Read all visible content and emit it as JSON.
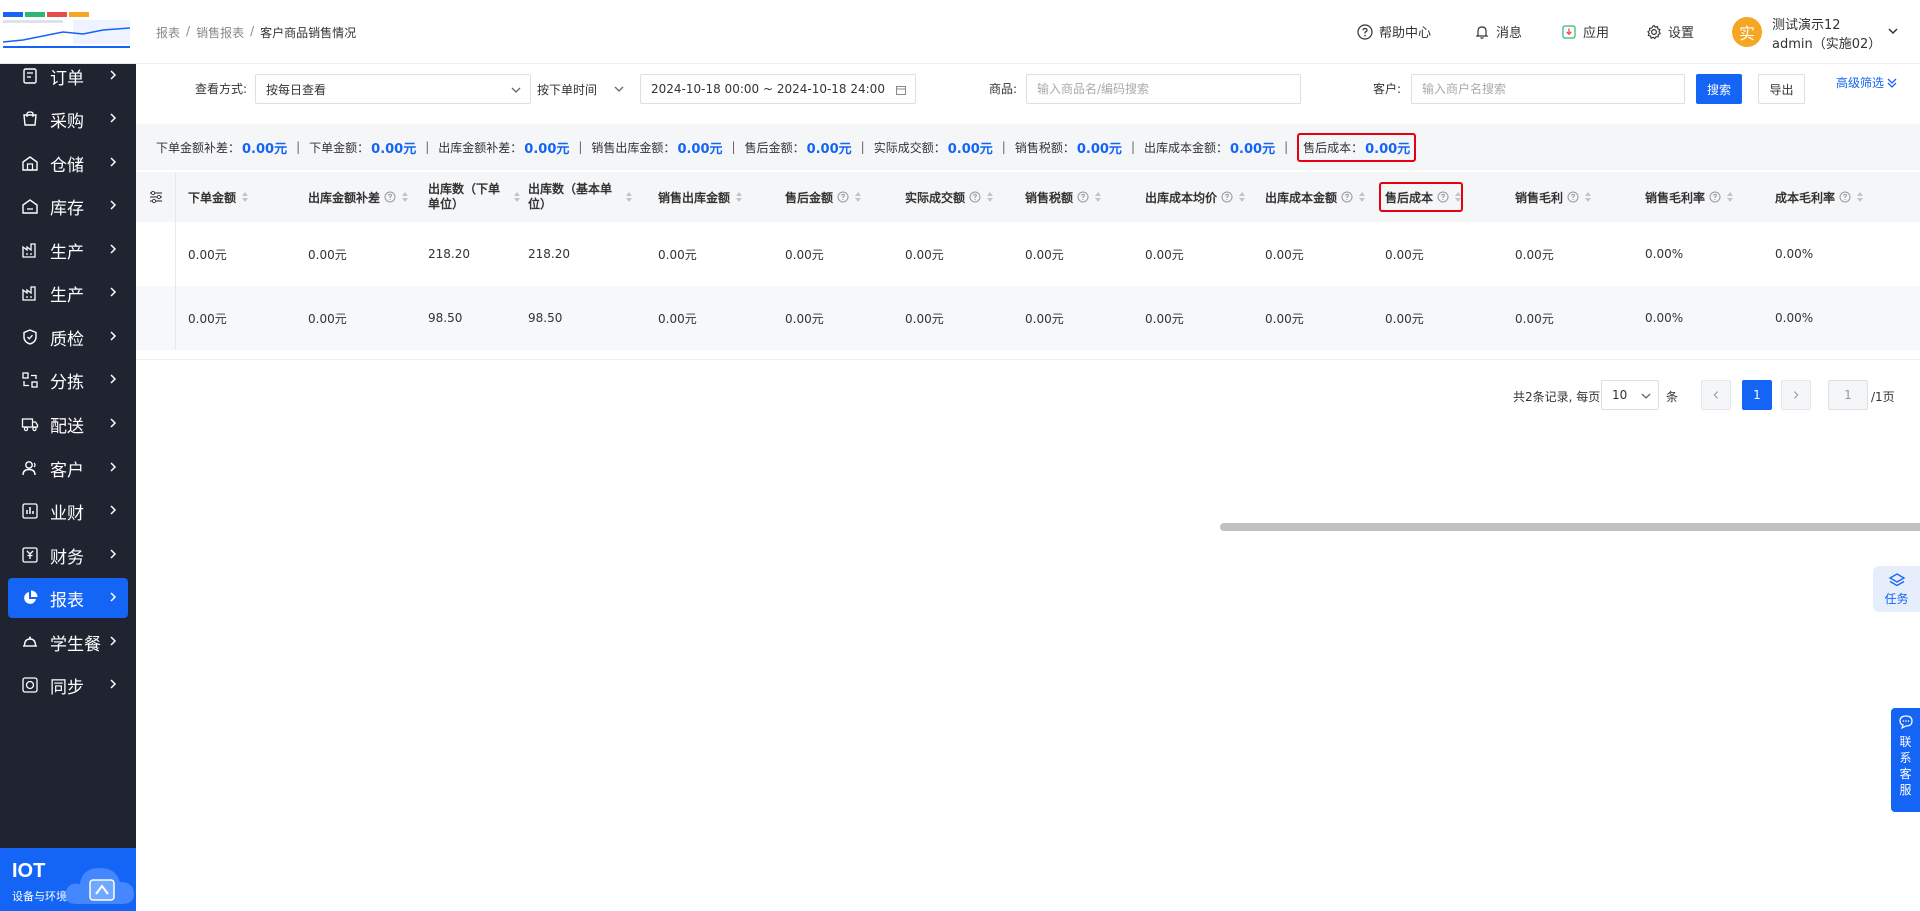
{
  "sidebar": {
    "items": [
      {
        "label": "订单",
        "icon": "order-icon"
      },
      {
        "label": "采购",
        "icon": "purchase-icon"
      },
      {
        "label": "仓储",
        "icon": "warehouse-icon"
      },
      {
        "label": "库存",
        "icon": "inventory-icon"
      },
      {
        "label": "生产",
        "icon": "factory-icon"
      },
      {
        "label": "生产",
        "icon": "factory-icon"
      },
      {
        "label": "质检",
        "icon": "shield-icon"
      },
      {
        "label": "分拣",
        "icon": "sort-icon"
      },
      {
        "label": "配送",
        "icon": "truck-icon"
      },
      {
        "label": "客户",
        "icon": "user-icon"
      },
      {
        "label": "业财",
        "icon": "bar-chart-icon"
      },
      {
        "label": "财务",
        "icon": "finance-icon"
      },
      {
        "label": "报表",
        "icon": "pie-chart-icon",
        "active": true
      },
      {
        "label": "学生餐",
        "icon": "dish-icon"
      },
      {
        "label": "同步",
        "icon": "sync-icon"
      }
    ],
    "iot": {
      "title": "IOT",
      "subtitle": "设备与环境"
    }
  },
  "header": {
    "breadcrumb": [
      "报表",
      "销售报表",
      "客户商品销售情况"
    ],
    "help": "帮助中心",
    "message": "消息",
    "apps": "应用",
    "settings": "设置",
    "avatar_char": "实",
    "user_name": "测试演示12",
    "user_sub": "admin（实施02）"
  },
  "filter": {
    "view_mode_label": "查看方式:",
    "view_mode_value": "按每日查看",
    "time_type": "按下单时间",
    "date_range": "2024-10-18 00:00 ~ 2024-10-18 24:00",
    "product_label": "商品:",
    "product_placeholder": "输入商品名/编码搜索",
    "customer_label": "客户:",
    "customer_placeholder": "输入商户名搜索",
    "search_btn": "搜索",
    "export_btn": "导出",
    "advanced": "高级筛选"
  },
  "summary": [
    {
      "label": "下单金额补差：",
      "value": "0.00元"
    },
    {
      "label": "下单金额：",
      "value": "0.00元"
    },
    {
      "label": "出库金额补差：",
      "value": "0.00元"
    },
    {
      "label": "销售出库金额：",
      "value": "0.00元"
    },
    {
      "label": "售后金额：",
      "value": "0.00元"
    },
    {
      "label": "实际成交额：",
      "value": "0.00元"
    },
    {
      "label": "销售税额：",
      "value": "0.00元"
    },
    {
      "label": "出库成本金额：",
      "value": "0.00元"
    },
    {
      "label": "售后成本：",
      "value": "0.00元",
      "highlight": true
    }
  ],
  "table": {
    "columns": [
      {
        "label": "下单金额",
        "help": false
      },
      {
        "label": "出库金额补差",
        "help": true
      },
      {
        "label": "出库数（下单单位）",
        "help": false
      },
      {
        "label": "出库数（基本单位）",
        "help": false
      },
      {
        "label": "销售出库金额",
        "help": false
      },
      {
        "label": "售后金额",
        "help": true
      },
      {
        "label": "实际成交额",
        "help": true
      },
      {
        "label": "销售税额",
        "help": true
      },
      {
        "label": "出库成本均价",
        "help": true
      },
      {
        "label": "出库成本金额",
        "help": true
      },
      {
        "label": "售后成本",
        "help": true,
        "highlight": true
      },
      {
        "label": "销售毛利",
        "help": true
      },
      {
        "label": "销售毛利率",
        "help": true
      },
      {
        "label": "成本毛利率",
        "help": true
      }
    ],
    "rows": [
      [
        "0.00元",
        "0.00元",
        "218.20",
        "218.20",
        "0.00元",
        "0.00元",
        "0.00元",
        "0.00元",
        "0.00元",
        "0.00元",
        "0.00元",
        "0.00元",
        "0.00%",
        "0.00%"
      ],
      [
        "0.00元",
        "0.00元",
        "98.50",
        "98.50",
        "0.00元",
        "0.00元",
        "0.00元",
        "0.00元",
        "0.00元",
        "0.00元",
        "0.00元",
        "0.00元",
        "0.00%",
        "0.00%"
      ]
    ]
  },
  "pagination": {
    "total_text": "共2条记录, 每页",
    "page_size": "10",
    "unit": "条",
    "current": "1",
    "jump_value": "1",
    "total_pages": "/1页"
  },
  "floating": {
    "task": "任务",
    "service": [
      "联",
      "系",
      "客",
      "服"
    ]
  },
  "colors": {
    "primary": "#1464f6",
    "sidebar_bg": "#1f2430",
    "highlight_border": "#e60012"
  }
}
